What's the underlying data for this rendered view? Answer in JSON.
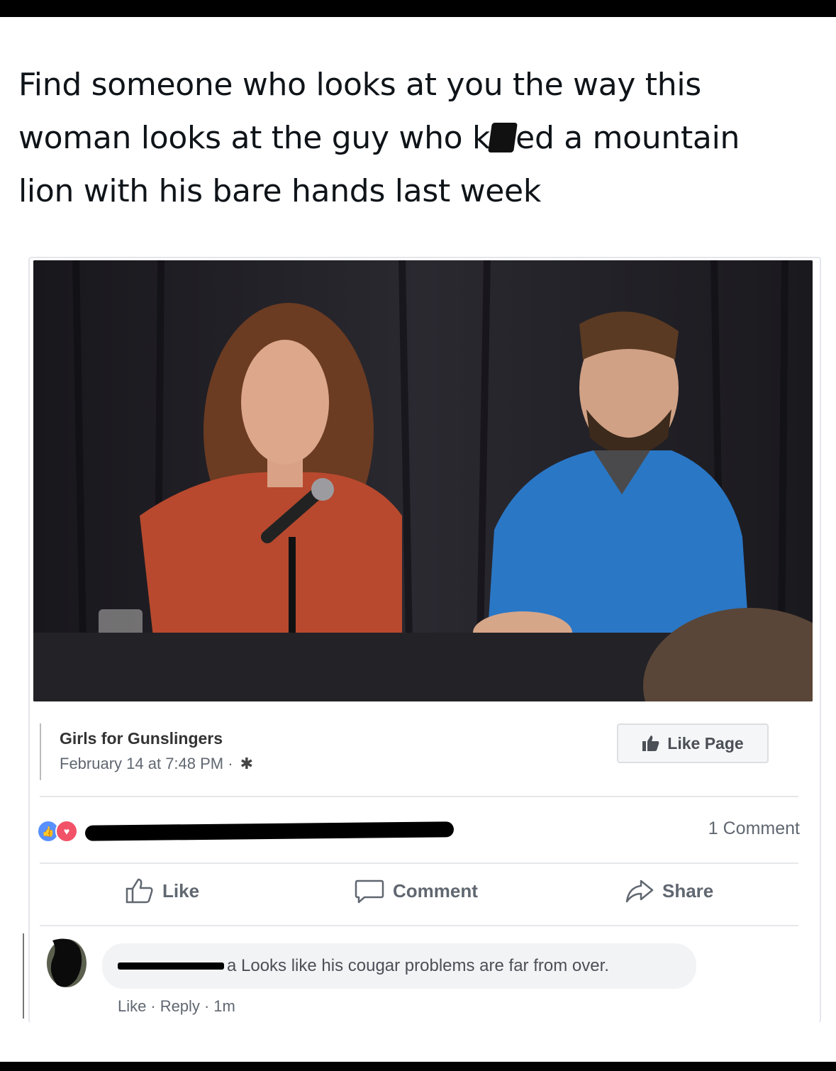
{
  "caption": {
    "line1": "Find someone who looks at you the way this",
    "line2_before": "woman looks at the guy who k",
    "line2_after": "ed a mountain",
    "line3": "lion with his bare hands last week"
  },
  "post": {
    "page_name": "Girls for Gunslingers",
    "date": "February 14 at 7:48 PM · ",
    "like_page_label": "Like Page",
    "comment_count": "1 Comment",
    "actions": {
      "like": "Like",
      "comment": "Comment",
      "share": "Share"
    }
  },
  "comment": {
    "text_fragment": "a Looks like his cougar problems are far from over.",
    "like_link": "Like",
    "reply_link": "Reply",
    "time": "1m"
  },
  "colors": {
    "reaction_like": "#5890ff",
    "reaction_love": "#f25268",
    "muted_text": "#606770"
  }
}
